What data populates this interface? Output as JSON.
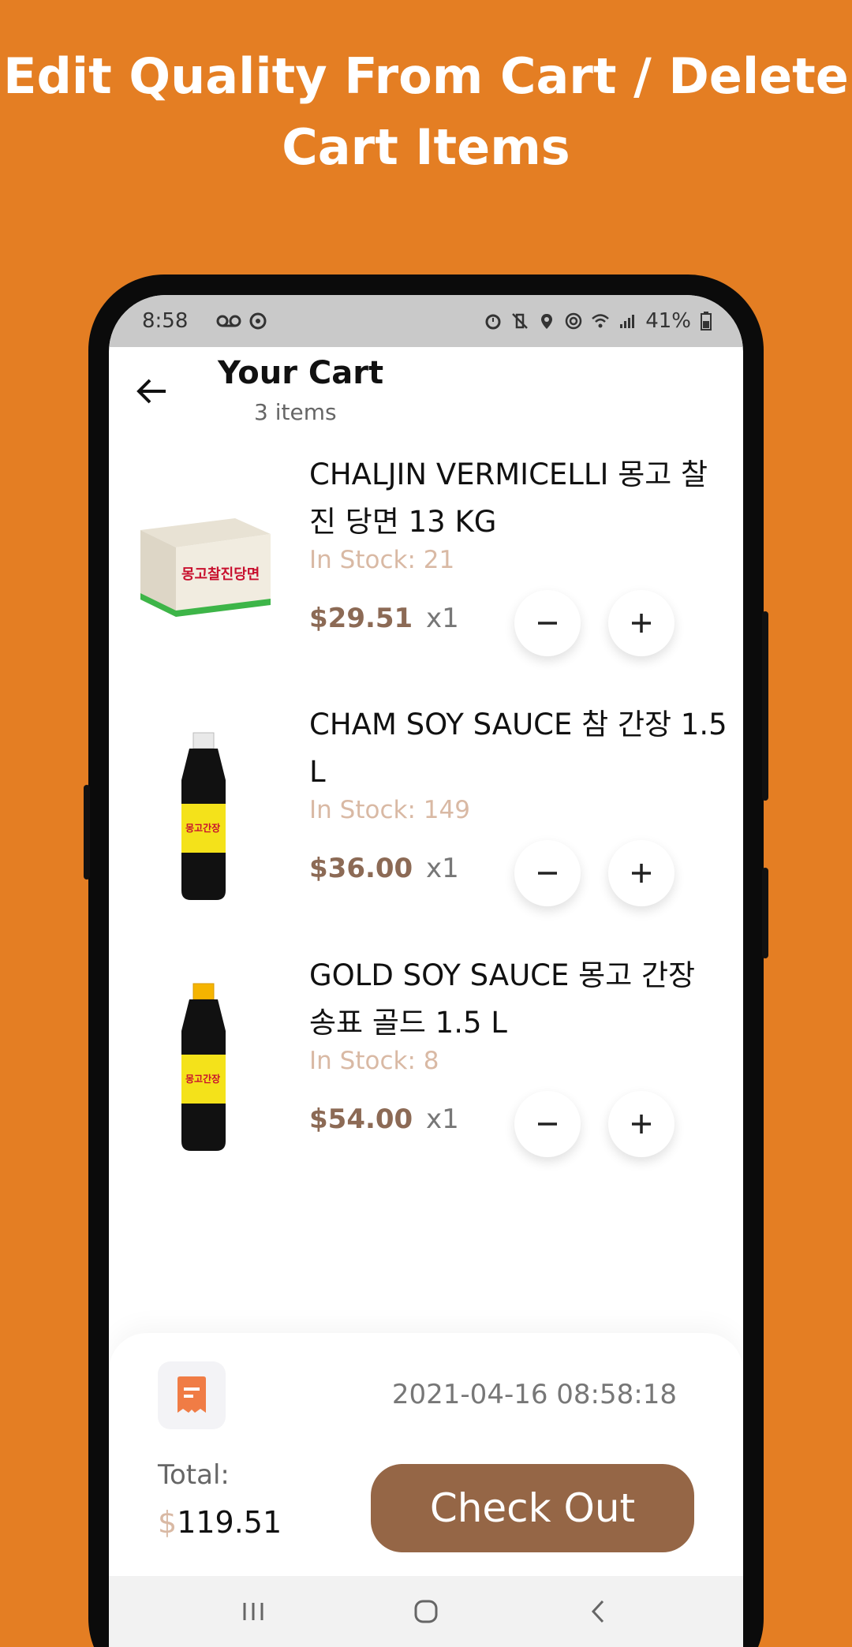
{
  "headline": {
    "line1": "Edit Quality From Cart / Delete",
    "line2": "Cart Items"
  },
  "status_bar": {
    "time": "8:58",
    "battery": "41%"
  },
  "app_bar": {
    "title": "Your Cart",
    "subtitle": "3 items"
  },
  "cart_items": [
    {
      "name": "CHALJIN VERMICELLI 몽고 찰진 당면 13 KG",
      "stock_label": "In Stock:",
      "stock": "21",
      "price": "$29.51",
      "qty": "x1"
    },
    {
      "name": "CHAM SOY SAUCE 참 간장 1.5 L",
      "stock_label": "In Stock:",
      "stock": "149",
      "price": "$36.00",
      "qty": "x1"
    },
    {
      "name": "GOLD SOY SAUCE 몽고 간장 송표 골드 1.5 L",
      "stock_label": "In Stock:",
      "stock": "8",
      "price": "$54.00",
      "qty": "x1"
    }
  ],
  "summary": {
    "timestamp": "2021-04-16 08:58:18",
    "total_label": "Total:",
    "total_currency": "$",
    "total_amount": "119.51",
    "checkout_label": "Check Out"
  },
  "colors": {
    "background": "#E47E23",
    "price": "#8C6A55",
    "stock": "#D9B9A4",
    "checkout": "#956646",
    "receipt_icon": "#F07C45"
  },
  "product_labels": {
    "box_text": "몽고찰진당면",
    "bottle1_text": "몽고간장",
    "bottle2_text": "몽고간장"
  }
}
